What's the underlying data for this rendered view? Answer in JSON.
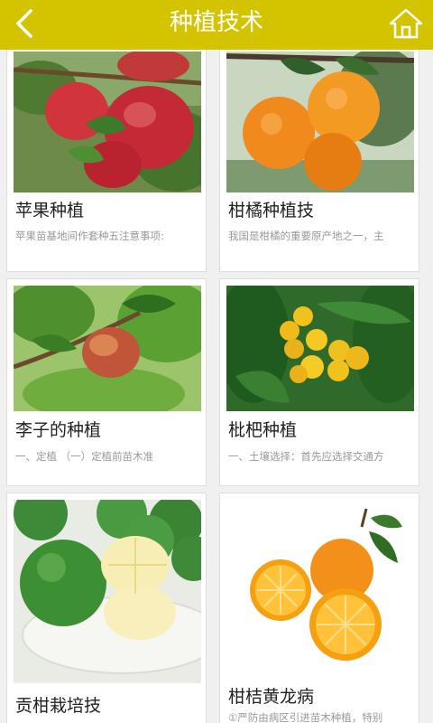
{
  "header": {
    "title": "种植技术",
    "color": "#d4c400"
  },
  "icons": {
    "back": "chevron-left-icon",
    "home": "home-icon"
  },
  "cards": [
    {
      "name": "苹果种植",
      "desc": "苹果苗基地间作套种五注意事项:"
    },
    {
      "name": "柑橘种植技",
      "desc": "我国是柑橘的重要原产地之一，主"
    },
    {
      "name": "李子的种植",
      "desc": "一、定植        （一）定植前苗木准"
    },
    {
      "name": "枇杷种植",
      "desc": "一、土壤选择：首先应选择交通方"
    },
    {
      "name": "贡柑栽培技",
      "desc": ""
    },
    {
      "name": "柑桔黄龙病",
      "desc": "①严防由病区引进苗木种植，特别"
    }
  ]
}
